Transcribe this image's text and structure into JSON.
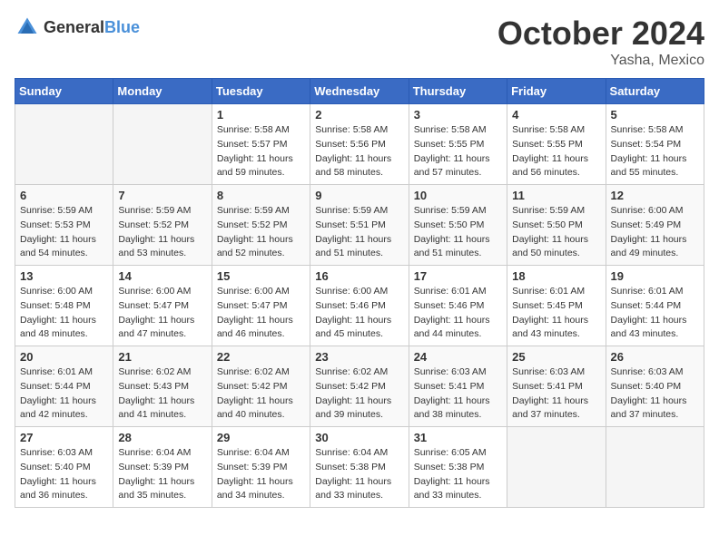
{
  "header": {
    "logo_general": "General",
    "logo_blue": "Blue",
    "month": "October 2024",
    "location": "Yasha, Mexico"
  },
  "days_of_week": [
    "Sunday",
    "Monday",
    "Tuesday",
    "Wednesday",
    "Thursday",
    "Friday",
    "Saturday"
  ],
  "weeks": [
    [
      {
        "day": "",
        "sunrise": "",
        "sunset": "",
        "daylight": "",
        "empty": true
      },
      {
        "day": "",
        "sunrise": "",
        "sunset": "",
        "daylight": "",
        "empty": true
      },
      {
        "day": "1",
        "sunrise": "Sunrise: 5:58 AM",
        "sunset": "Sunset: 5:57 PM",
        "daylight": "Daylight: 11 hours and 59 minutes.",
        "empty": false
      },
      {
        "day": "2",
        "sunrise": "Sunrise: 5:58 AM",
        "sunset": "Sunset: 5:56 PM",
        "daylight": "Daylight: 11 hours and 58 minutes.",
        "empty": false
      },
      {
        "day": "3",
        "sunrise": "Sunrise: 5:58 AM",
        "sunset": "Sunset: 5:55 PM",
        "daylight": "Daylight: 11 hours and 57 minutes.",
        "empty": false
      },
      {
        "day": "4",
        "sunrise": "Sunrise: 5:58 AM",
        "sunset": "Sunset: 5:55 PM",
        "daylight": "Daylight: 11 hours and 56 minutes.",
        "empty": false
      },
      {
        "day": "5",
        "sunrise": "Sunrise: 5:58 AM",
        "sunset": "Sunset: 5:54 PM",
        "daylight": "Daylight: 11 hours and 55 minutes.",
        "empty": false
      }
    ],
    [
      {
        "day": "6",
        "sunrise": "Sunrise: 5:59 AM",
        "sunset": "Sunset: 5:53 PM",
        "daylight": "Daylight: 11 hours and 54 minutes.",
        "empty": false
      },
      {
        "day": "7",
        "sunrise": "Sunrise: 5:59 AM",
        "sunset": "Sunset: 5:52 PM",
        "daylight": "Daylight: 11 hours and 53 minutes.",
        "empty": false
      },
      {
        "day": "8",
        "sunrise": "Sunrise: 5:59 AM",
        "sunset": "Sunset: 5:52 PM",
        "daylight": "Daylight: 11 hours and 52 minutes.",
        "empty": false
      },
      {
        "day": "9",
        "sunrise": "Sunrise: 5:59 AM",
        "sunset": "Sunset: 5:51 PM",
        "daylight": "Daylight: 11 hours and 51 minutes.",
        "empty": false
      },
      {
        "day": "10",
        "sunrise": "Sunrise: 5:59 AM",
        "sunset": "Sunset: 5:50 PM",
        "daylight": "Daylight: 11 hours and 51 minutes.",
        "empty": false
      },
      {
        "day": "11",
        "sunrise": "Sunrise: 5:59 AM",
        "sunset": "Sunset: 5:50 PM",
        "daylight": "Daylight: 11 hours and 50 minutes.",
        "empty": false
      },
      {
        "day": "12",
        "sunrise": "Sunrise: 6:00 AM",
        "sunset": "Sunset: 5:49 PM",
        "daylight": "Daylight: 11 hours and 49 minutes.",
        "empty": false
      }
    ],
    [
      {
        "day": "13",
        "sunrise": "Sunrise: 6:00 AM",
        "sunset": "Sunset: 5:48 PM",
        "daylight": "Daylight: 11 hours and 48 minutes.",
        "empty": false
      },
      {
        "day": "14",
        "sunrise": "Sunrise: 6:00 AM",
        "sunset": "Sunset: 5:47 PM",
        "daylight": "Daylight: 11 hours and 47 minutes.",
        "empty": false
      },
      {
        "day": "15",
        "sunrise": "Sunrise: 6:00 AM",
        "sunset": "Sunset: 5:47 PM",
        "daylight": "Daylight: 11 hours and 46 minutes.",
        "empty": false
      },
      {
        "day": "16",
        "sunrise": "Sunrise: 6:00 AM",
        "sunset": "Sunset: 5:46 PM",
        "daylight": "Daylight: 11 hours and 45 minutes.",
        "empty": false
      },
      {
        "day": "17",
        "sunrise": "Sunrise: 6:01 AM",
        "sunset": "Sunset: 5:46 PM",
        "daylight": "Daylight: 11 hours and 44 minutes.",
        "empty": false
      },
      {
        "day": "18",
        "sunrise": "Sunrise: 6:01 AM",
        "sunset": "Sunset: 5:45 PM",
        "daylight": "Daylight: 11 hours and 43 minutes.",
        "empty": false
      },
      {
        "day": "19",
        "sunrise": "Sunrise: 6:01 AM",
        "sunset": "Sunset: 5:44 PM",
        "daylight": "Daylight: 11 hours and 43 minutes.",
        "empty": false
      }
    ],
    [
      {
        "day": "20",
        "sunrise": "Sunrise: 6:01 AM",
        "sunset": "Sunset: 5:44 PM",
        "daylight": "Daylight: 11 hours and 42 minutes.",
        "empty": false
      },
      {
        "day": "21",
        "sunrise": "Sunrise: 6:02 AM",
        "sunset": "Sunset: 5:43 PM",
        "daylight": "Daylight: 11 hours and 41 minutes.",
        "empty": false
      },
      {
        "day": "22",
        "sunrise": "Sunrise: 6:02 AM",
        "sunset": "Sunset: 5:42 PM",
        "daylight": "Daylight: 11 hours and 40 minutes.",
        "empty": false
      },
      {
        "day": "23",
        "sunrise": "Sunrise: 6:02 AM",
        "sunset": "Sunset: 5:42 PM",
        "daylight": "Daylight: 11 hours and 39 minutes.",
        "empty": false
      },
      {
        "day": "24",
        "sunrise": "Sunrise: 6:03 AM",
        "sunset": "Sunset: 5:41 PM",
        "daylight": "Daylight: 11 hours and 38 minutes.",
        "empty": false
      },
      {
        "day": "25",
        "sunrise": "Sunrise: 6:03 AM",
        "sunset": "Sunset: 5:41 PM",
        "daylight": "Daylight: 11 hours and 37 minutes.",
        "empty": false
      },
      {
        "day": "26",
        "sunrise": "Sunrise: 6:03 AM",
        "sunset": "Sunset: 5:40 PM",
        "daylight": "Daylight: 11 hours and 37 minutes.",
        "empty": false
      }
    ],
    [
      {
        "day": "27",
        "sunrise": "Sunrise: 6:03 AM",
        "sunset": "Sunset: 5:40 PM",
        "daylight": "Daylight: 11 hours and 36 minutes.",
        "empty": false
      },
      {
        "day": "28",
        "sunrise": "Sunrise: 6:04 AM",
        "sunset": "Sunset: 5:39 PM",
        "daylight": "Daylight: 11 hours and 35 minutes.",
        "empty": false
      },
      {
        "day": "29",
        "sunrise": "Sunrise: 6:04 AM",
        "sunset": "Sunset: 5:39 PM",
        "daylight": "Daylight: 11 hours and 34 minutes.",
        "empty": false
      },
      {
        "day": "30",
        "sunrise": "Sunrise: 6:04 AM",
        "sunset": "Sunset: 5:38 PM",
        "daylight": "Daylight: 11 hours and 33 minutes.",
        "empty": false
      },
      {
        "day": "31",
        "sunrise": "Sunrise: 6:05 AM",
        "sunset": "Sunset: 5:38 PM",
        "daylight": "Daylight: 11 hours and 33 minutes.",
        "empty": false
      },
      {
        "day": "",
        "sunrise": "",
        "sunset": "",
        "daylight": "",
        "empty": true
      },
      {
        "day": "",
        "sunrise": "",
        "sunset": "",
        "daylight": "",
        "empty": true
      }
    ]
  ]
}
